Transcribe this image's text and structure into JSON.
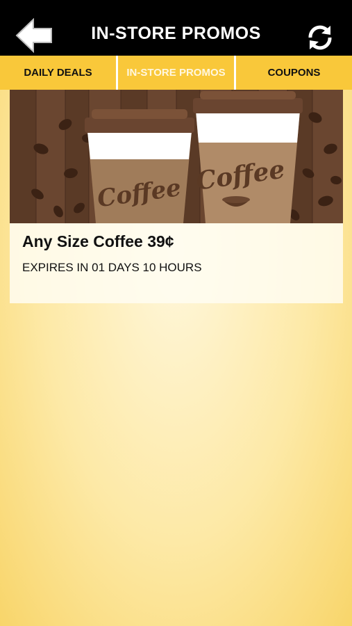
{
  "header": {
    "title": "IN-STORE PROMOS",
    "back_icon": "back-arrow-icon",
    "refresh_icon": "refresh-icon"
  },
  "tabs": [
    {
      "label": "DAILY DEALS",
      "active": false
    },
    {
      "label": "IN-STORE PROMOS",
      "active": true
    },
    {
      "label": "COUPONS",
      "active": false
    }
  ],
  "promo": {
    "image_text_1": "Coffee",
    "image_text_2": "Coffee",
    "title": "Any Size Coffee 39¢",
    "expiry": "EXPIRES IN 01 DAYS 10 HOURS"
  },
  "colors": {
    "header_bg": "#000000",
    "tab_bg": "#f9c83a",
    "active_tab_text": "#fff7e0"
  }
}
